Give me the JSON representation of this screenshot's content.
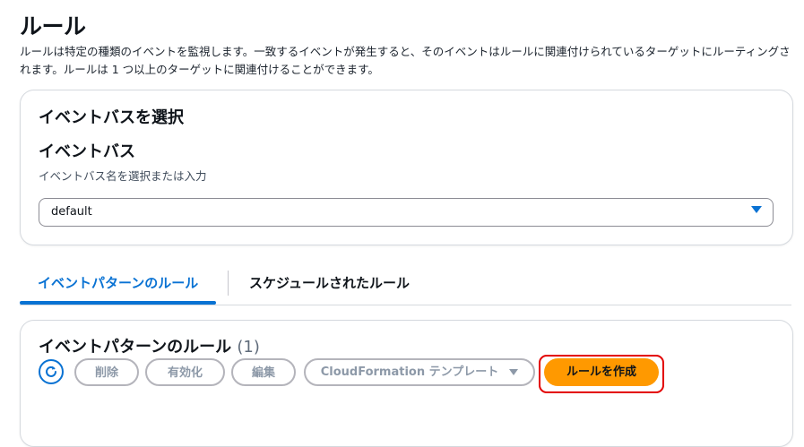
{
  "page": {
    "title": "ルール",
    "description": "ルールは特定の種類のイベントを監視します。一致するイベントが発生すると、そのイベントはルールに関連付けられているターゲットにルーティングされます。ルールは 1 つ以上のターゲットに関連付けることができます。"
  },
  "event_bus_card": {
    "heading": "イベントバスを選択",
    "field_label": "イベントバス",
    "field_hint": "イベントバス名を選択または入力",
    "selected_value": "default",
    "caret_icon": "caret-down-icon"
  },
  "tabs": [
    {
      "label": "イベントパターンのルール",
      "active": true
    },
    {
      "label": "スケジュールされたルール",
      "active": false
    }
  ],
  "rules_card": {
    "heading": "イベントパターンのルール",
    "count": "(1)",
    "toolbar": {
      "refresh_icon": "refresh-icon",
      "delete_label": "削除",
      "enable_label": "有効化",
      "edit_label": "編集",
      "cloudformation_label": "CloudFormation テンプレート",
      "create_label": "ルールを作成"
    }
  },
  "colors": {
    "accent": "#0972d3",
    "primary_button": "#ff9900",
    "highlight_border": "#e30000",
    "disabled_text": "#8d99a8"
  }
}
